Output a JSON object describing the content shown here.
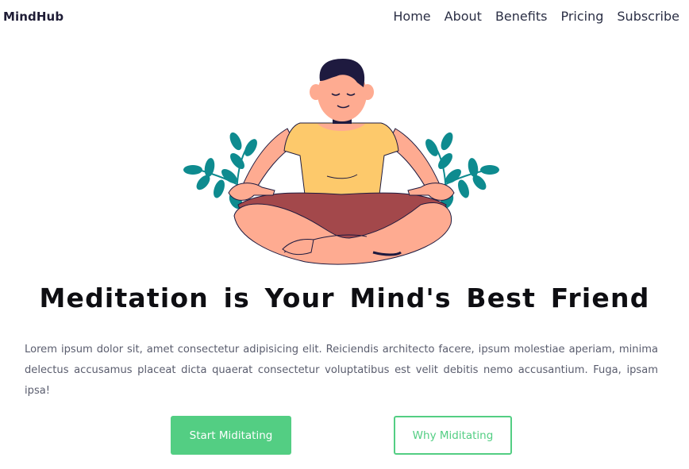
{
  "nav": {
    "brand": "MindHub",
    "links": [
      "Home",
      "About",
      "Benefits",
      "Pricing",
      "Subscribe"
    ]
  },
  "hero": {
    "illustration_icon": "meditating-person-illustration",
    "headline": "Meditation is Your Mind's Best Friend",
    "description": "Lorem ipsum dolor sit, amet consectetur adipisicing elit. Reiciendis architecto facere, ipsum molestiae aperiam, minima delectus accusamus placeat dicta quaerat consectetur voluptatibus est velit debitis nemo accusantium. Fuga, ipsam ipsa!",
    "primary_button": "Start Miditating",
    "secondary_button": "Why Miditating"
  },
  "colors": {
    "accent": "#53ce83",
    "text_dark": "#0e0e12",
    "text_muted": "#5a5d6e",
    "leaf": "#0e8b8f",
    "shirt": "#fdc96b",
    "shorts": "#a3484b",
    "skin": "#feab91",
    "hair": "#1e1a3f"
  }
}
